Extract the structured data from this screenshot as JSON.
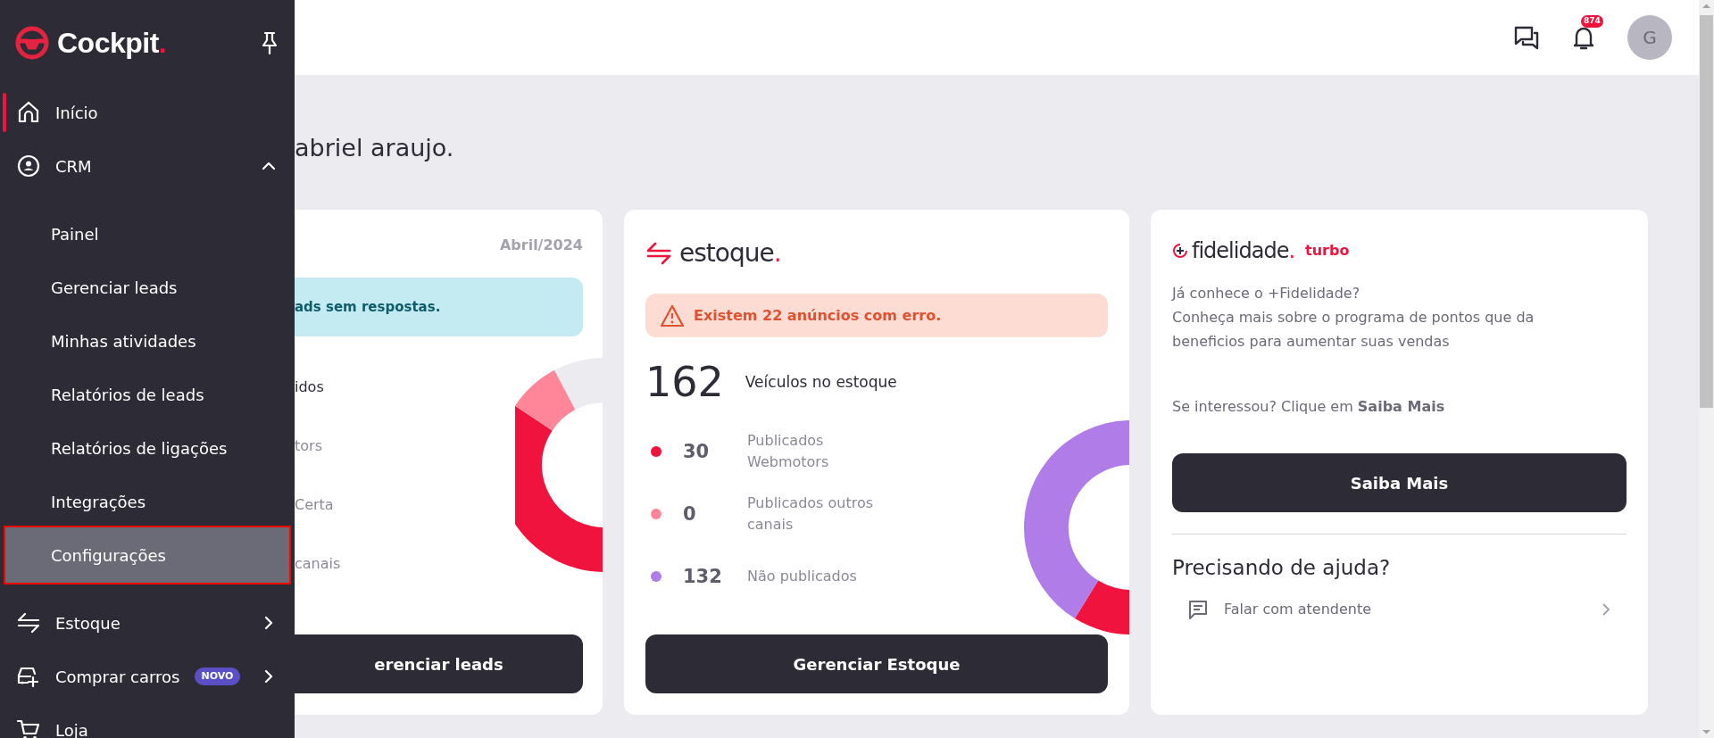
{
  "sidebar": {
    "logo": {
      "text": "Cockpit",
      "dot": "."
    },
    "items": [
      {
        "label": "Início",
        "selected": true
      },
      {
        "label": "CRM",
        "selected": false,
        "expanded": true,
        "children": [
          {
            "label": "Painel",
            "selected": false
          },
          {
            "label": "Gerenciar leads",
            "selected": false
          },
          {
            "label": "Minhas atividades",
            "selected": false
          },
          {
            "label": "Relatórios de leads",
            "selected": false
          },
          {
            "label": "Relatórios de ligações",
            "selected": false
          },
          {
            "label": "Integrações",
            "selected": false
          },
          {
            "label": "Configurações",
            "selected": true
          }
        ]
      },
      {
        "label": "Estoque",
        "selected": false,
        "expanded": false
      },
      {
        "label": "Comprar carros",
        "badge": "NOVO",
        "selected": false,
        "expanded": false
      },
      {
        "label": "Loja",
        "selected": false
      }
    ]
  },
  "header": {
    "notifications_count": "874",
    "avatar_initial": "G"
  },
  "greeting": "abriel araujo.",
  "leads_card": {
    "period": "Abril/2024",
    "alert": "ads sem respostas.",
    "legend": [
      "idos",
      "tors",
      "Certa",
      "canais"
    ],
    "button": "erenciar leads"
  },
  "estoque_card": {
    "logo": "estoque",
    "logo_dot": ".",
    "alert": "Existem 22 anúncios com erro.",
    "total": "162",
    "total_label": "Veículos no estoque",
    "legend": [
      {
        "value": "30",
        "label": "Publicados Webmotors",
        "color": "#f0133d"
      },
      {
        "value": "0",
        "label": "Publicados outros canais",
        "color": "#ff8599"
      },
      {
        "value": "132",
        "label": "Não publicados",
        "color": "#b07ce8"
      }
    ],
    "button": "Gerenciar Estoque"
  },
  "fidelidade_card": {
    "logo": "fidelidade",
    "logo_dot": ".",
    "logo_tag": "turbo",
    "intro_lines": [
      "Já conhece o +Fidelidade?",
      "Conheça mais sobre o programa de pontos que da beneficios para aumentar suas vendas"
    ],
    "cta_text": "Se interessou? Clique em **Saiba Mais**",
    "button": "Saiba Mais",
    "help_title": "Precisando de ajuda?",
    "help_link": "Falar com atendente"
  }
}
